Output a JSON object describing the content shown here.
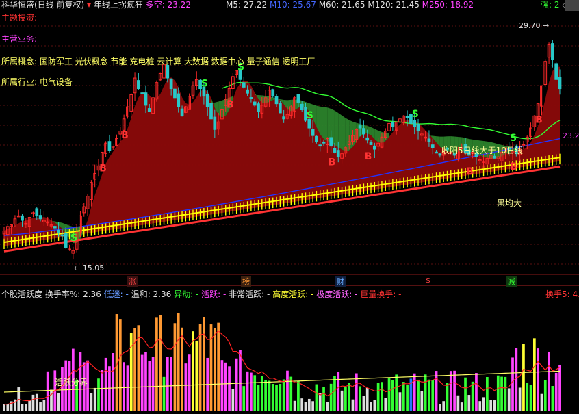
{
  "header": {
    "stock_name": "科华恒盛",
    "period": "(日线 前复权)",
    "indicator_title": "年线上拐疯狂",
    "duokong_label": "多空:",
    "duokong_value": "23.22",
    "ma5": "M5: 27.22",
    "ma10": "M10: 25.67",
    "ma60": "M60: 21.65",
    "ma120": "M120: 21.45",
    "ma250": "M250: 18.92",
    "strong_label": "强: 2",
    "diamond_icon": "◇"
  },
  "info": {
    "theme_label": "主题投资:",
    "business_label": "主营业务:",
    "concepts_label": "所属概念:",
    "concepts_value": "国防军工 光伏概念 节能 充电桩 云计算 大数据 数据中心 量子通信 透明工厂",
    "industry_label": "所属行业:",
    "industry_value": "电气设备"
  },
  "chart_annotations": {
    "high_price": "29.70",
    "low_price": "15.05",
    "right_price": "23.22",
    "signal_text": "收阳5日线大于10日线",
    "cross_text": "黑均大",
    "b_marker": "B",
    "s_marker": "S"
  },
  "event_tags": [
    "涨",
    "榜",
    "财",
    "$",
    "减"
  ],
  "sub_header": {
    "title": "个股活跃度",
    "turnover": "换手率%: 2.36",
    "lowmood": "低迷: -",
    "mild": "温和: 2.36",
    "move": "异动: -",
    "active": "活跃: -",
    "very_active": "非常活跃: -",
    "high_active": "高度活跃: -",
    "extreme_active": "极度活跃: -",
    "huge_turnover": "巨量换手: -",
    "right_value": "换手5: 4."
  },
  "sub_annotation": "活跃分界",
  "colors": {
    "up": "#ff2a2a",
    "down": "#28c8c8",
    "ribbon_red": "#8b0a0a",
    "ribbon_green": "#2d8a2d",
    "ma_blue": "#2233ff",
    "ma_green": "#33ff33",
    "yellow": "#ffff00"
  },
  "chart_data": {
    "type": "candlestick",
    "closes": [
      16.6,
      16.9,
      17.0,
      17.4,
      17.6,
      17.3,
      17.1,
      17.5,
      17.8,
      17.6,
      17.4,
      17.3,
      17.2,
      17.0,
      16.8,
      16.5,
      16.3,
      15.5,
      15.4,
      15.3,
      16.5,
      17.6,
      18.2,
      18.9,
      19.8,
      20.4,
      20.9,
      21.8,
      22.4,
      21.9,
      22.2,
      22.7,
      23.2,
      24.0,
      24.8,
      25.6,
      26.7,
      26.0,
      25.7,
      24.9,
      24.5,
      25.4,
      26.4,
      27.0,
      27.6,
      26.7,
      26.0,
      25.4,
      24.8,
      24.2,
      24.8,
      25.5,
      26.2,
      26.6,
      26.0,
      25.5,
      24.8,
      24.0,
      23.3,
      23.8,
      24.6,
      25.3,
      26.0,
      26.8,
      27.2,
      26.6,
      26.1,
      25.7,
      25.4,
      24.9,
      24.5,
      24.9,
      25.4,
      25.9,
      25.5,
      25.0,
      24.4,
      24.0,
      24.3,
      24.8,
      25.4,
      25.1,
      24.6,
      23.9,
      23.4,
      22.9,
      22.5,
      22.2,
      22.4,
      22.7,
      22.2,
      21.8,
      21.5,
      21.7,
      22.1,
      22.5,
      22.9,
      23.3,
      23.4,
      23.0,
      22.6,
      22.3,
      22.0,
      22.4,
      22.8,
      23.2,
      23.7,
      23.5,
      23.8,
      24.0,
      24.2,
      24.1,
      23.7,
      23.5,
      23.2,
      23.0,
      22.8,
      22.5,
      22.1,
      21.8,
      21.6,
      21.8,
      22.0,
      21.8,
      21.6,
      21.9,
      22.1,
      21.8,
      21.6,
      21.8,
      21.5,
      21.3,
      21.2,
      21.4,
      21.6,
      21.4,
      21.5,
      21.8,
      22.1,
      22.0,
      21.9,
      21.7,
      22.0,
      22.3,
      22.8,
      23.4,
      24.2,
      25.0,
      26.2,
      27.8,
      28.9,
      27.9,
      26.6,
      26.0
    ]
  }
}
